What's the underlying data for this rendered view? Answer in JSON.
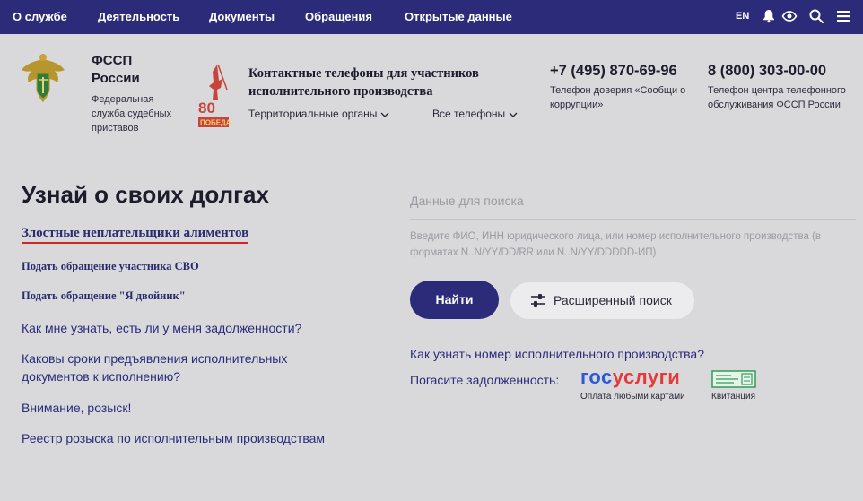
{
  "topnav": {
    "items": [
      "О службе",
      "Деятельность",
      "Документы",
      "Обращения",
      "Открытые данные"
    ],
    "lang": "EN",
    "icons": [
      "bell-icon",
      "eye-icon",
      "search-icon",
      "menu-icon"
    ]
  },
  "header": {
    "org_title": "ФССП России",
    "org_subtitle": "Федеральная служба судебных приставов",
    "contacts_title": "Контактные телефоны для участников исполнительного производства",
    "dropdown_territorial": "Территориальные органы",
    "dropdown_all_phones": "Все телефоны",
    "phone1": "+7 (495) 870-69-96",
    "phone1_note": "Телефон доверия «Сообщи о коррупции»",
    "phone2": "8 (800) 303-00-00",
    "phone2_note": "Телефон центра телефонного обслуживания ФССП России"
  },
  "left": {
    "title": "Узнай о своих долгах",
    "alimony_link": "Злостные неплательщики алиментов",
    "svo_link": "Подать обращение участника СВО",
    "twin_link": "Подать обращение \"Я двойник\"",
    "links": [
      "Как мне узнать, есть ли у меня задолженности?",
      "Каковы сроки предъявления исполнительных документов к исполнению?",
      "Внимание, розыск!",
      "Реестр розыска по исполнительным производствам"
    ]
  },
  "search": {
    "placeholder": "Данные для поиска",
    "hint": "Введите ФИО, ИНН юридического лица, или номер исполнительного производства (в форматах N..N/YY/DD/RR или N..N/YY/DDDDD-ИП)",
    "find_button": "Найти",
    "advanced_button": "Расширенный поиск"
  },
  "payment": {
    "how_link": "Как узнать номер исполнительного производства?",
    "pay_label": "Погасите задолженность:",
    "gosuslugi_part1": "гос",
    "gosuslugi_part2": "услуги",
    "cards_label": "Оплата любыми картами",
    "receipt_label": "Квитанция"
  },
  "colors": {
    "nav_bg": "#2b2b7a",
    "page_bg": "#d9d9dc",
    "link": "#2b2b7a",
    "accent_red": "#d32424"
  }
}
